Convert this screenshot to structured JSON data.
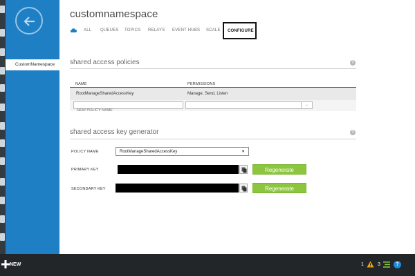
{
  "header": {
    "title": "customnamespace",
    "tabs": [
      "ALL",
      "QUEUES",
      "TOPICS",
      "RELAYS",
      "EVENT HUBS",
      "SCALE",
      "CONFIGURE"
    ],
    "active_tab": "CONFIGURE"
  },
  "nav": {
    "selected_item": "CustomNamespace"
  },
  "policies": {
    "title": "shared access policies",
    "columns": [
      "NAME",
      "PERMISSIONS"
    ],
    "rows": [
      {
        "name": "RootManageSharedAccessKey",
        "permissions": "Manage, Send, Listen"
      }
    ],
    "new_policy_placeholder": "NEW POLICY NAME"
  },
  "keygen": {
    "title": "shared access key generator",
    "policy_name_label": "POLICY NAME",
    "policy_name_value": "RootManageSharedAccessKey",
    "primary_key_label": "PRIMARY KEY",
    "secondary_key_label": "SECONDARY KEY",
    "regenerate_label": "Regenerate"
  },
  "bottombar": {
    "new_label": "NEW",
    "warning_count": "1",
    "list_count": "3"
  },
  "colors": {
    "nav_blue": "#1f7fc4",
    "regenerate_green": "#8cc63f",
    "bottom_bar": "#222629"
  }
}
